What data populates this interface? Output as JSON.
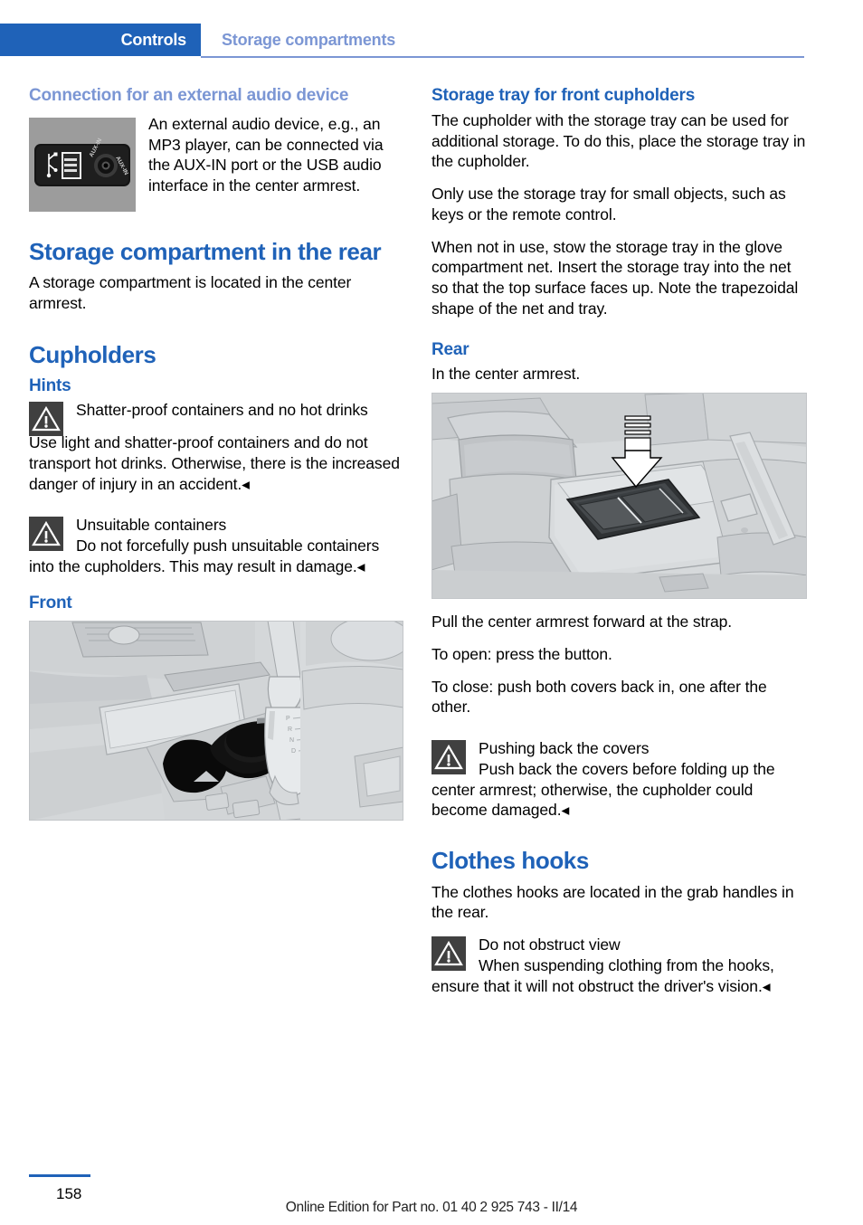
{
  "header": {
    "tab_label": "Controls",
    "section_label": "Storage compartments"
  },
  "left_column": {
    "audio_heading": "Connection for an external audio device",
    "audio_figure_alt": "aux-in-usb-port-panel",
    "audio_text": "An external audio device, e.g., an MP3 player, can be connected via the AUX-IN port or the USB audio interface in the center armrest.",
    "rear_storage_heading": "Storage compartment in the rear",
    "rear_storage_text": "A storage compartment is located in the center armrest.",
    "cupholders_heading": "Cupholders",
    "hints_heading": "Hints",
    "warning_1": {
      "title": "Shatter-proof containers and no hot drinks",
      "text": "Use light and shatter-proof containers and do not transport hot drinks. Otherwise, there is the increased danger of injury in an accident.◂"
    },
    "warning_2": {
      "title": "Unsuitable containers",
      "text": "Do not forcefully push unsuitable containers into the cupholders. This may result in damage.◂"
    },
    "front_heading": "Front",
    "front_figure_alt": "front-center-console-cupholders-illustration"
  },
  "right_column": {
    "storage_tray_heading": "Storage tray for front cupholders",
    "storage_tray_p1": "The cupholder with the storage tray can be used for additional storage. To do this, place the storage tray in the cupholder.",
    "storage_tray_p2": "Only use the storage tray for small objects, such as keys or the remote control.",
    "storage_tray_p3": "When not in use, stow the storage tray in the glove compartment net. Insert the storage tray into the net so that the top surface faces up. Note the trapezoidal shape of the net and tray.",
    "rear_heading": "Rear",
    "rear_text": "In the center armrest.",
    "rear_figure_alt": "rear-center-armrest-cupholder-illustration",
    "rear_p1": "Pull the center armrest forward at the strap.",
    "rear_p2": "To open: press the button.",
    "rear_p3": "To close: push both covers back in, one after the other.",
    "warning_3": {
      "title": "Pushing back the covers",
      "text": "Push back the covers before folding up the center armrest; otherwise, the cupholder could become damaged.◂"
    },
    "clothes_hooks_heading": "Clothes hooks",
    "clothes_hooks_text": "The clothes hooks are located in the grab handles in the rear.",
    "warning_4": {
      "title": "Do not obstruct view",
      "text": "When suspending clothing from the hooks, ensure that it will not obstruct the driver's vision.◂"
    }
  },
  "figure_labels": {
    "aux_in_left": "AUX-IN",
    "aux_in_right": "AUX-IN"
  },
  "footer": {
    "page_number": "158",
    "edition_text": "Online Edition for Part no. 01 40 2 925 743 - II/14"
  },
  "colors": {
    "accent_blue": "#1f62b8",
    "faded_blue": "#7b96d4",
    "warning_icon_bg": "#404040",
    "figure_gray": "#c9ccce"
  }
}
